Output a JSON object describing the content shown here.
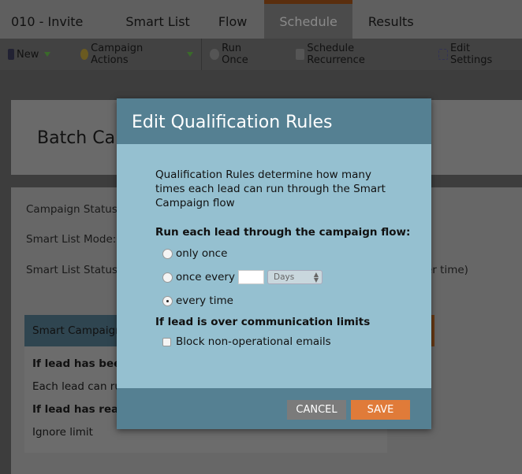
{
  "tabs": [
    {
      "label": "010 - Invite"
    },
    {
      "label": "Smart List"
    },
    {
      "label": "Flow"
    },
    {
      "label": "Schedule",
      "active": true
    },
    {
      "label": "Results"
    }
  ],
  "toolbar": {
    "new": "New",
    "campaign_actions": "Campaign Actions",
    "run_once": "Run Once",
    "schedule_recurrence": "Schedule Recurrence",
    "edit_settings": "Edit Settings"
  },
  "page": {
    "title": "Batch Ca",
    "campaign_status": "Campaign Status:",
    "smart_list_mode": "Smart List Mode:",
    "smart_list_status": "Smart List Status:",
    "smart_list_status_tail": "er time)",
    "section_header": "Smart Campaign",
    "rule1_title": "If lead has been",
    "rule1_value": "Each lead can ru",
    "rule2_title": "If lead has reac",
    "rule2_value": "Ignore limit"
  },
  "modal": {
    "title": "Edit Qualification Rules",
    "intro": "Qualification Rules determine how many times each lead can run through the Smart Campaign flow",
    "question": "Run each lead through the campaign flow:",
    "options": [
      {
        "label": "only once",
        "selected": false
      },
      {
        "label": "once every",
        "selected": false
      },
      {
        "label": "every time",
        "selected": true
      }
    ],
    "interval_value": "",
    "interval_unit": "Days",
    "limits_title": "If lead is over communication limits",
    "block_label": "Block non-operational emails",
    "block_checked": false,
    "cancel": "CANCEL",
    "save": "SAVE"
  },
  "colors": {
    "modal_header": "#558092",
    "modal_body": "#95c0d0",
    "save": "#e07b39",
    "cancel": "#7b7b7b"
  }
}
